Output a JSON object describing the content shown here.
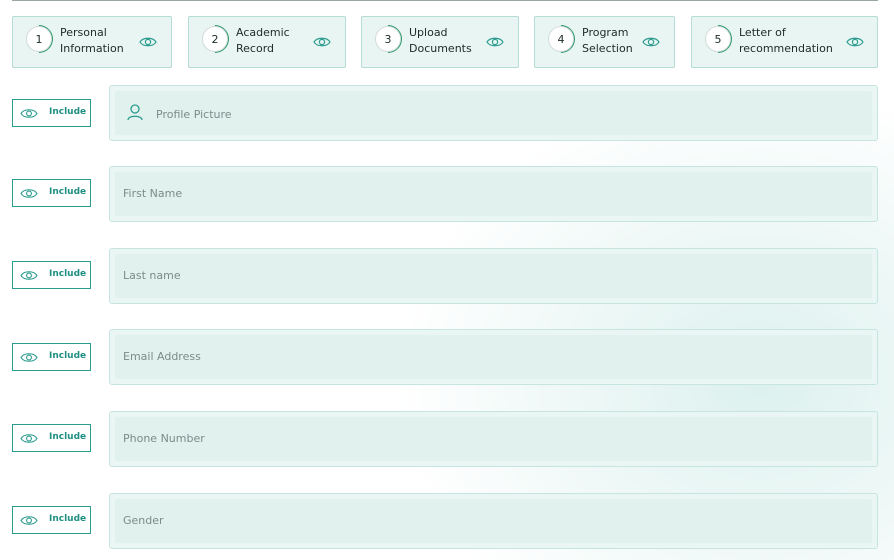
{
  "steps": [
    {
      "number": "1",
      "label": "Personal\nInformation"
    },
    {
      "number": "2",
      "label": "Academic\nRecord"
    },
    {
      "number": "3",
      "label": "Upload\nDocuments"
    },
    {
      "number": "4",
      "label": "Program\nSelection"
    },
    {
      "number": "5",
      "label": "Letter of\nrecommendation"
    }
  ],
  "fields": [
    {
      "include_label": "Include",
      "placeholder": "Profile Picture"
    },
    {
      "include_label": "Include",
      "placeholder": "First Name"
    },
    {
      "include_label": "Include",
      "placeholder": "Last name"
    },
    {
      "include_label": "Include",
      "placeholder": "Email Address"
    },
    {
      "include_label": "Include",
      "placeholder": "Phone Number"
    },
    {
      "include_label": "Include",
      "placeholder": "Gender"
    }
  ],
  "colors": {
    "accent": "#2a9b8d",
    "step_bg": "#e8f5f3",
    "field_bg": "#e0f1ee",
    "progress_arc": "#2f9a6b"
  },
  "icons": {
    "step_visibility": "eye-icon",
    "include_toggle": "eye-icon",
    "profile": "user-icon"
  }
}
